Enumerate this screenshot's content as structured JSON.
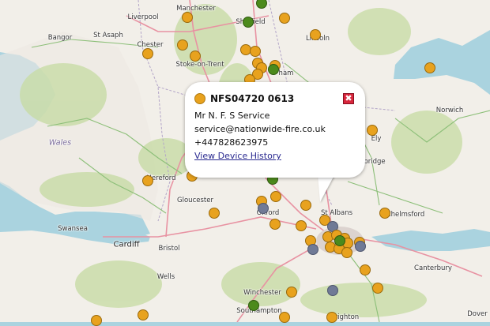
{
  "map": {
    "places": [
      {
        "name": "Manchester",
        "cls": ""
      },
      {
        "name": "Liverpool",
        "cls": ""
      },
      {
        "name": "Sheffield",
        "cls": ""
      },
      {
        "name": "Bangor",
        "cls": ""
      },
      {
        "name": "St Asaph",
        "cls": ""
      },
      {
        "name": "Chester",
        "cls": ""
      },
      {
        "name": "Stoke-on-Trent",
        "cls": ""
      },
      {
        "name": "Lincoln",
        "cls": ""
      },
      {
        "name": "ham",
        "cls": ""
      },
      {
        "name": "Norwich",
        "cls": ""
      },
      {
        "name": "Ely",
        "cls": ""
      },
      {
        "name": "Wales",
        "cls": "wales"
      },
      {
        "name": "bridge",
        "cls": ""
      },
      {
        "name": "Hereford",
        "cls": ""
      },
      {
        "name": "Gloucester",
        "cls": ""
      },
      {
        "name": "Oxford",
        "cls": ""
      },
      {
        "name": "St Albans",
        "cls": ""
      },
      {
        "name": "Chelmsford",
        "cls": ""
      },
      {
        "name": "Swansea",
        "cls": ""
      },
      {
        "name": "Cardiff",
        "cls": "big"
      },
      {
        "name": "Bristol",
        "cls": ""
      },
      {
        "name": "Wells",
        "cls": ""
      },
      {
        "name": "Canterbury",
        "cls": ""
      },
      {
        "name": "Winchester",
        "cls": ""
      },
      {
        "name": "Southampton",
        "cls": ""
      },
      {
        "name": "Brighton",
        "cls": ""
      },
      {
        "name": "Dover",
        "cls": ""
      }
    ],
    "marker_colors": {
      "orange": "#e8a21e",
      "green": "#4c8a1c",
      "grey": "#707a96"
    }
  },
  "popup": {
    "status_color": "#e8a21e",
    "title": "NFS04720 0613",
    "contact_name": "Mr N. F. S Service",
    "email": "service@nationwide-fire.co.uk",
    "phone": "+447828623975",
    "link_label": "View Device History",
    "close_icon": "close-icon"
  }
}
